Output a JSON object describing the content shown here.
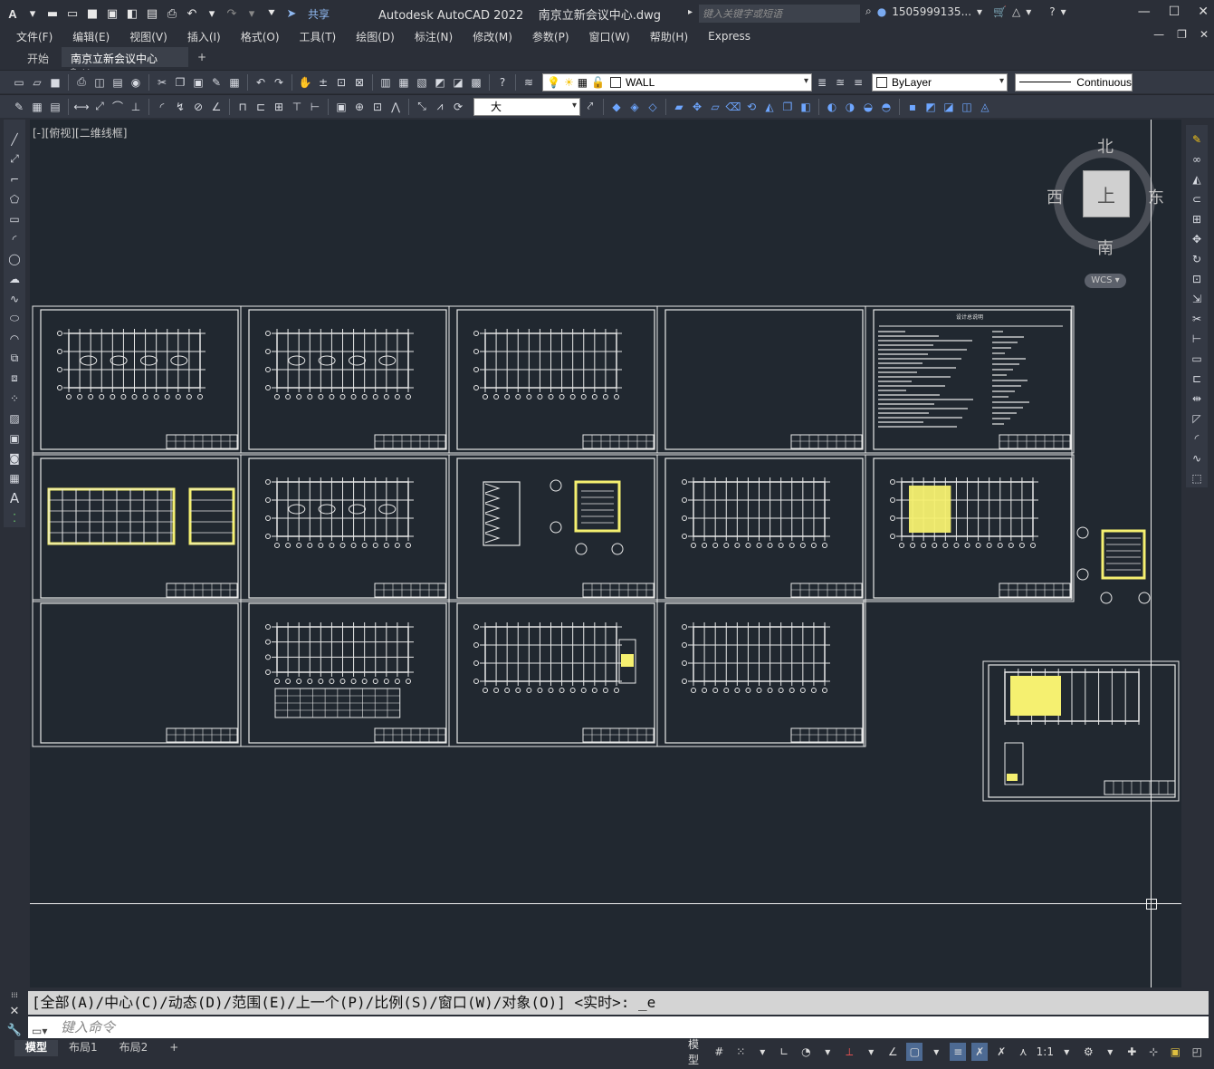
{
  "titlebar": {
    "app_title": "Autodesk AutoCAD 2022",
    "doc_title": "南京立新会议中心.dwg",
    "share_label": "共享",
    "search_placeholder": "键入关键字或短语",
    "user": "1505999135...",
    "qat_icons": [
      "new-icon",
      "open-icon",
      "save-icon",
      "saveas-icon",
      "publish-icon",
      "plot-icon",
      "print-icon",
      "undo-icon",
      "redo-icon"
    ]
  },
  "menubar": {
    "items": [
      "文件(F)",
      "编辑(E)",
      "视图(V)",
      "插入(I)",
      "格式(O)",
      "工具(T)",
      "绘图(D)",
      "标注(N)",
      "修改(M)",
      "参数(P)",
      "窗口(W)",
      "帮助(H)",
      "Express"
    ]
  },
  "tabs": {
    "start": "开始",
    "active": "南京立新会议中心*",
    "add": "+"
  },
  "toolbar1": {
    "layer": "WALL",
    "color": "ByLayer",
    "linetype": "Continuous"
  },
  "toolbar2": {
    "text_style": "大"
  },
  "viewport": {
    "label": "[-][俯视][二维线框]"
  },
  "viewcube": {
    "north": "北",
    "south": "南",
    "east": "东",
    "west": "西",
    "face": "上",
    "wcs": "WCS"
  },
  "sheets": {
    "notes_title": "设计总说明"
  },
  "command": {
    "history": "[全部(A)/中心(C)/动态(D)/范围(E)/上一个(P)/比例(S)/窗口(W)/对象(O)] <实时>: _e",
    "placeholder": "键入命令"
  },
  "statusbar": {
    "tabs": [
      "模型",
      "布局1",
      "布局2"
    ],
    "add": "+",
    "model": "模型",
    "scale": "1:1"
  },
  "colors": {
    "canvas_bg": "#212830",
    "ui_bg": "#2b2f38",
    "highlight": "#f5f070"
  }
}
